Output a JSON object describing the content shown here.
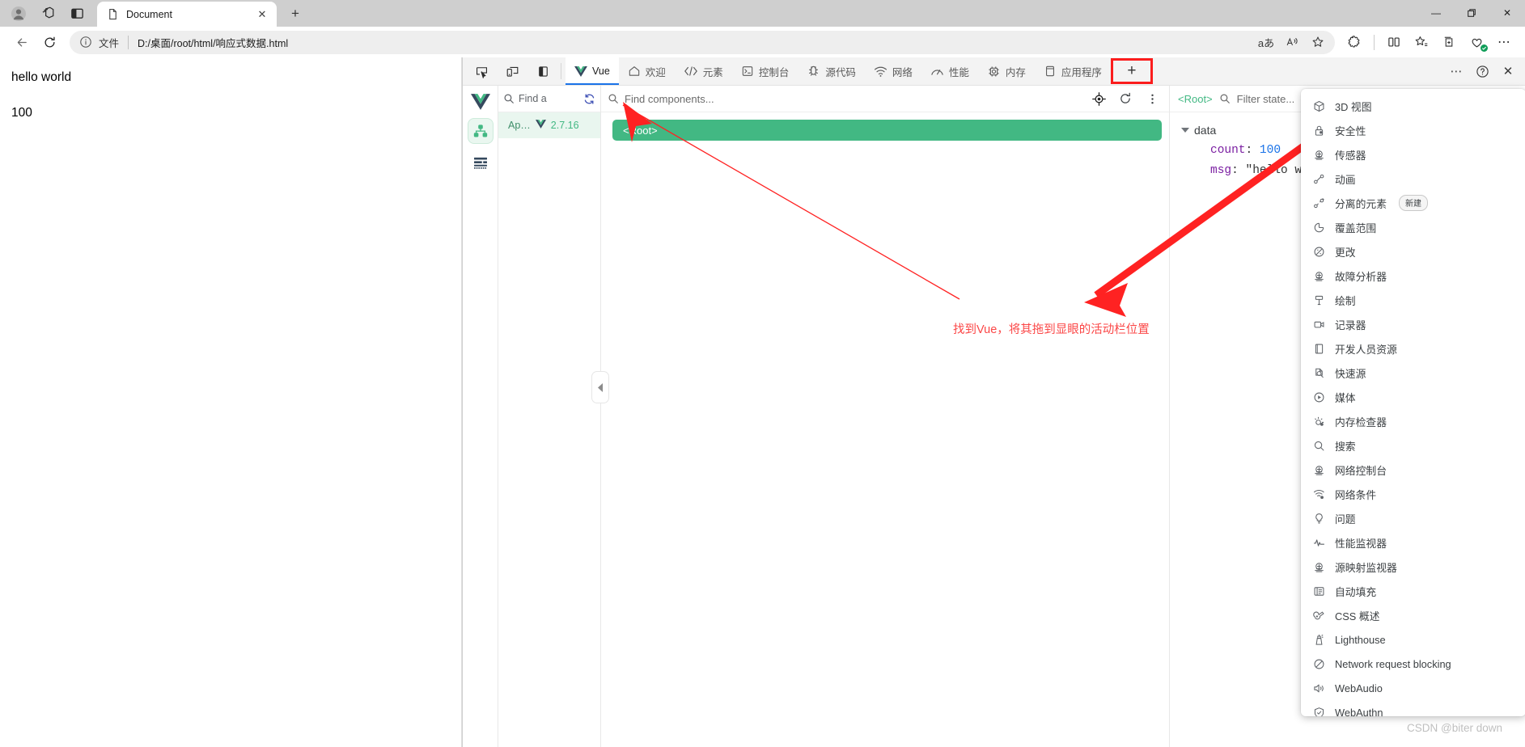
{
  "browser": {
    "window_controls": {
      "minimize": "—",
      "maximize": "❐",
      "close": "✕"
    },
    "tab": {
      "title": "Document",
      "close_label": "✕"
    },
    "new_tab_label": "+",
    "address": {
      "scheme_label": "文件",
      "url": "D:/桌面/root/html/响应式数据.html",
      "url_dim_tail": ".html",
      "read_aloud_label": "aあ",
      "immersive_label": "A",
      "favorite_label": "☆"
    }
  },
  "page": {
    "lines": [
      "hello world",
      "100"
    ]
  },
  "devtools": {
    "tabs": [
      {
        "label": "Vue",
        "icon": "vue-icon",
        "selected": true
      },
      {
        "label": "欢迎",
        "icon": "home-icon",
        "selected": false
      },
      {
        "label": "元素",
        "icon": "code-brackets-icon",
        "selected": false
      },
      {
        "label": "控制台",
        "icon": "console-icon",
        "selected": false
      },
      {
        "label": "源代码",
        "icon": "bug-icon",
        "selected": false
      },
      {
        "label": "网络",
        "icon": "wifi-icon",
        "selected": false
      },
      {
        "label": "性能",
        "icon": "gauge-icon",
        "selected": false
      },
      {
        "label": "内存",
        "icon": "chip-icon",
        "selected": false
      },
      {
        "label": "应用程序",
        "icon": "app-icon",
        "selected": false
      }
    ],
    "add_panel_label": "+",
    "more_label": "⋯",
    "help_label": "?",
    "close_label": "✕",
    "highlight_color": "#fb1d1d"
  },
  "vue_panel": {
    "app_search_placeholder": "Find a",
    "refresh_label": "refresh-icon",
    "app": {
      "name": "Ap…",
      "version": "2.7.16"
    },
    "component_search_placeholder": "Find components...",
    "root_node_label": "<Root>",
    "state": {
      "scope_label": "<Root>",
      "filter_placeholder": "Filter state...",
      "group_label": "data",
      "entries": [
        {
          "key": "count",
          "value": "100",
          "type": "number"
        },
        {
          "key": "msg",
          "value": "\"hello world\"",
          "type": "string"
        }
      ]
    }
  },
  "annotation": {
    "text": "找到Vue，将其拖到显眼的活动栏位置",
    "color": "#fb4747"
  },
  "dropdown": {
    "items": [
      {
        "label": "3D 视图",
        "icon": "cube-icon"
      },
      {
        "label": "安全性",
        "icon": "lock-icon"
      },
      {
        "label": "传感器",
        "icon": "sensors-icon"
      },
      {
        "label": "动画",
        "icon": "animation-icon"
      },
      {
        "label": "分离的元素",
        "icon": "detached-elements-icon",
        "badge": "新建"
      },
      {
        "label": "覆盖范围",
        "icon": "coverage-icon"
      },
      {
        "label": "更改",
        "icon": "changes-icon"
      },
      {
        "label": "故障分析器",
        "icon": "issues-analyzer-icon"
      },
      {
        "label": "绘制",
        "icon": "rendering-icon"
      },
      {
        "label": "记录器",
        "icon": "recorder-icon"
      },
      {
        "label": "开发人员资源",
        "icon": "developer-resources-icon"
      },
      {
        "label": "快速源",
        "icon": "quick-source-icon"
      },
      {
        "label": "媒体",
        "icon": "media-icon"
      },
      {
        "label": "内存检查器",
        "icon": "memory-inspector-icon"
      },
      {
        "label": "搜索",
        "icon": "search-icon"
      },
      {
        "label": "网络控制台",
        "icon": "network-console-icon"
      },
      {
        "label": "网络条件",
        "icon": "network-conditions-icon"
      },
      {
        "label": "问题",
        "icon": "issues-icon"
      },
      {
        "label": "性能监视器",
        "icon": "performance-monitor-icon"
      },
      {
        "label": "源映射监视器",
        "icon": "sourcemap-monitor-icon"
      },
      {
        "label": "自动填充",
        "icon": "autofill-icon"
      },
      {
        "label": "CSS 概述",
        "icon": "css-overview-icon"
      },
      {
        "label": "Lighthouse",
        "icon": "lighthouse-icon"
      },
      {
        "label": "Network request blocking",
        "icon": "blocking-icon"
      },
      {
        "label": "WebAudio",
        "icon": "webaudio-icon"
      },
      {
        "label": "WebAuthn",
        "icon": "webauthn-icon"
      }
    ]
  },
  "watermark": {
    "text": "CSDN @biter down"
  }
}
